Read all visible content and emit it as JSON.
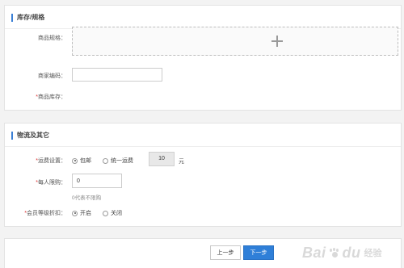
{
  "inventory": {
    "title": "库存/规格",
    "spec_label": "商品规格：",
    "code_label": "商家编码：",
    "code_value": "",
    "stock_label_req": "*",
    "stock_label": "商品库存："
  },
  "logistics": {
    "title": "物流及其它",
    "shipping_label_req": "*",
    "shipping_label": "运费设置：",
    "shipping_options": [
      "包邮",
      "统一运费"
    ],
    "shipping_selected": "包邮",
    "fee_value": "10",
    "fee_unit": "元",
    "limit_label_req": "*",
    "limit_label": "每人限购：",
    "limit_value": "0",
    "limit_hint": "0代表不限购",
    "discount_label_req": "*",
    "discount_label": "会员等级折扣：",
    "discount_options": [
      "开启",
      "关闭"
    ],
    "discount_selected": "开启"
  },
  "footer": {
    "prev_label": "上一步",
    "next_label": "下一步"
  },
  "watermark": {
    "brand": "Bai",
    "brand_tail": "du",
    "sub": "经验"
  },
  "colors": {
    "accent": "#2f7fd8",
    "required": "#dd3333"
  }
}
